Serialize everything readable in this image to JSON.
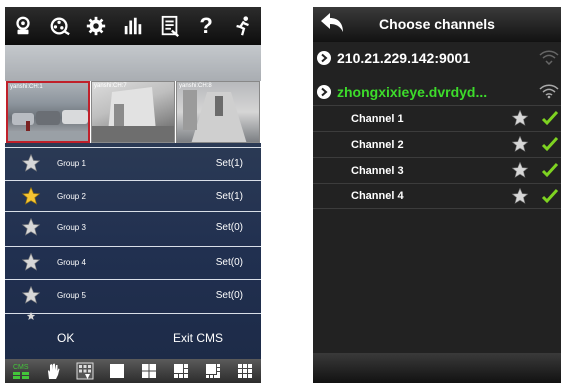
{
  "left_screen": {
    "toolbar_icons": [
      "camera-config-icon",
      "film-reel-icon",
      "settings-gear-icon",
      "stats-bars-icon",
      "document-list-icon",
      "help-icon",
      "exit-runner-icon"
    ],
    "help_glyph": "?",
    "video_labels": [
      "yanshi:CH:1",
      "yanshi:CH:7",
      "yanshi:CH:8"
    ],
    "groups": [
      {
        "name": "Group 1",
        "value": "Set(1)",
        "starred": false
      },
      {
        "name": "Group 2",
        "value": "Set(1)",
        "starred": true
      },
      {
        "name": "Group 3",
        "value": "Set(0)",
        "starred": false
      },
      {
        "name": "Group 4",
        "value": "Set(0)",
        "starred": false
      },
      {
        "name": "Group 5",
        "value": "Set(0)",
        "starred": false
      }
    ],
    "ok_label": "OK",
    "exit_label": "Exit CMS",
    "bottom_cms_label": "CMS",
    "bottom_icons": [
      "cms-icon",
      "hand-icon",
      "channel-grid-icon",
      "layout-1-icon",
      "layout-4-icon",
      "layout-6-icon",
      "layout-8-icon",
      "layout-9-icon"
    ],
    "colors": {
      "accent_green": "#43c43a",
      "selection_red": "#c0202a"
    }
  },
  "right_screen": {
    "title": "Choose channels",
    "devices": [
      {
        "name": "210.21.229.142:9001",
        "color": "#ffffff"
      },
      {
        "name": "zhongxixieye.dvrdyd...",
        "color": "#3ddc2b"
      }
    ],
    "channels": [
      "Channel 1",
      "Channel 2",
      "Channel 3",
      "Channel 4"
    ],
    "colors": {
      "check_green": "#7ed321",
      "device_active": "#3ddc2b"
    }
  }
}
